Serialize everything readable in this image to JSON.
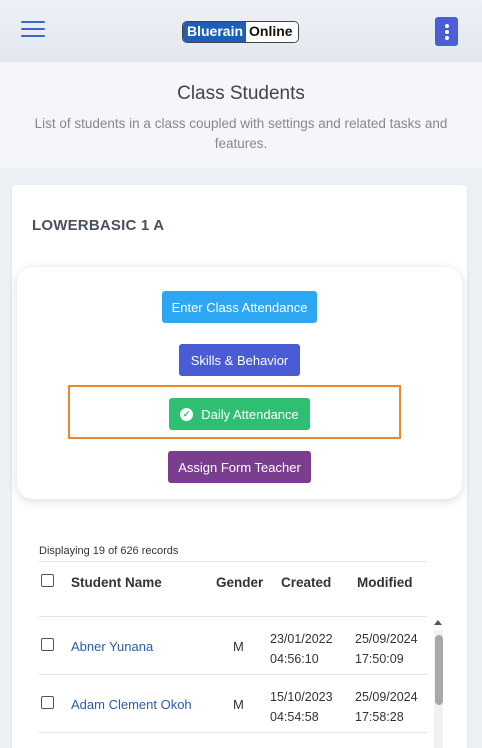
{
  "header": {
    "logo_part1": "Bluerain",
    "logo_part2": "Online"
  },
  "hero": {
    "title": "Class Students",
    "subtitle": "List of students in a class coupled with settings and related tasks and features."
  },
  "class_name": "LOWERBASIC 1 A",
  "actions": {
    "enter_attendance": "Enter Class Attendance",
    "skills": "Skills & Behavior",
    "daily": "Daily Attendance",
    "assign": "Assign Form Teacher"
  },
  "table": {
    "records_text": "Displaying 19 of 626 records",
    "headers": {
      "name": "Student Name",
      "gender": "Gender",
      "created": "Created",
      "modified": "Modified"
    },
    "rows": [
      {
        "name": "Abner Yunana",
        "gender": "M",
        "created_date": "23/01/2022",
        "created_time": "04:56:10",
        "modified_date": "25/09/2024",
        "modified_time": "17:50:09"
      },
      {
        "name": "Adam Clement Okoh",
        "gender": "M",
        "created_date": "15/10/2023",
        "created_time": "04:54:58",
        "modified_date": "25/09/2024",
        "modified_time": "17:58:28"
      }
    ]
  },
  "colors": {
    "primary_blue": "#2ea7f2",
    "indigo": "#4a5bd6",
    "green": "#2ebf73",
    "purple": "#7b3e8f",
    "highlight_orange": "#e88a2a"
  },
  "icons": {
    "menu": "hamburger-menu-icon",
    "more": "vertical-dots-icon",
    "check": "check-circle-icon"
  }
}
